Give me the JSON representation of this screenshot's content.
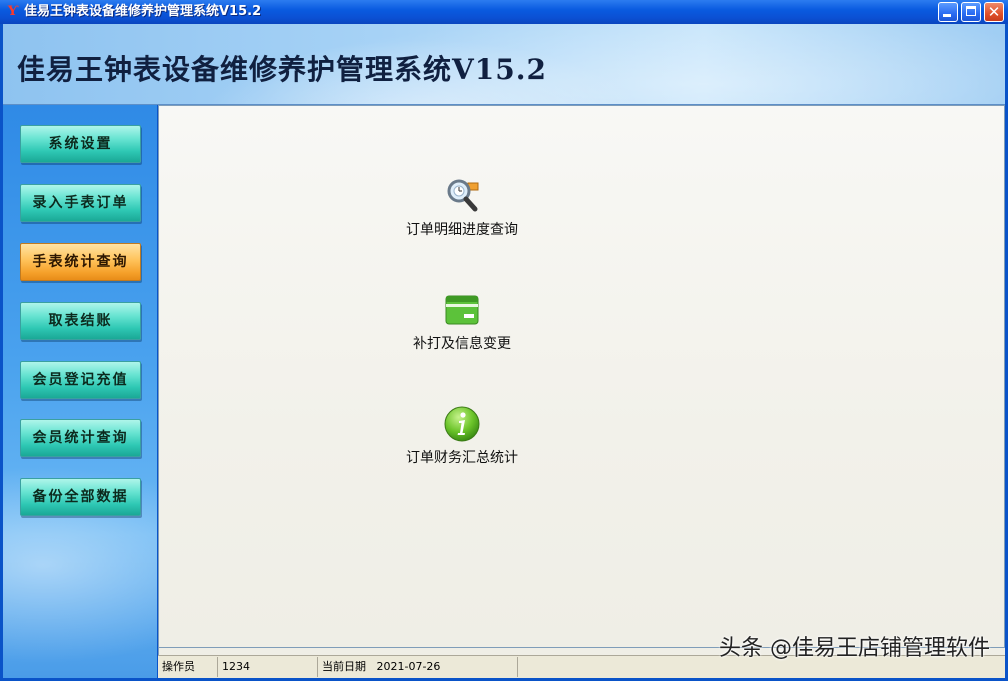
{
  "window": {
    "title": "佳易王钟表设备维修养护管理系统V15.2",
    "icon": "app-logo-icon",
    "controls": [
      "minimize",
      "maximize",
      "close"
    ]
  },
  "banner": {
    "title": "佳易王钟表设备维修养护管理系统V15.2"
  },
  "sidebar": {
    "items": [
      {
        "label": "系统设置",
        "active": false
      },
      {
        "label": "录入手表订单",
        "active": false
      },
      {
        "label": "手表统计查询",
        "active": true
      },
      {
        "label": "取表结账",
        "active": false
      },
      {
        "label": "会员登记充值",
        "active": false
      },
      {
        "label": "会员统计查询",
        "active": false
      },
      {
        "label": "备份全部数据",
        "active": false
      }
    ]
  },
  "main": {
    "functions": [
      {
        "label": "订单明细进度查询",
        "icon": "magnifier-icon"
      },
      {
        "label": "补打及信息变更",
        "icon": "card-icon"
      },
      {
        "label": "订单财务汇总统计",
        "icon": "info-icon"
      }
    ]
  },
  "statusbar": {
    "operator_label": "操作员",
    "operator_value": "1234",
    "date_label": "当前日期",
    "date_value": "2021-07-26"
  },
  "watermark": "头条 @佳易王店铺管理软件",
  "colors": {
    "titlebar": "#0b50d3",
    "nav_button": "#2fc8b4",
    "nav_button_active": "#f5a02a",
    "sidebar": "#4aa2ee",
    "main_bg": "#f2f1ea"
  }
}
